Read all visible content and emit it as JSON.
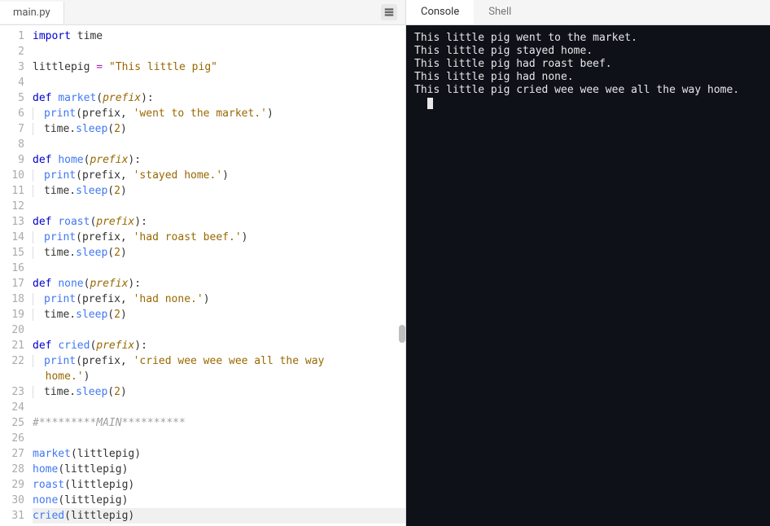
{
  "editor": {
    "filename": "main.py",
    "lines": [
      {
        "n": 1,
        "tokens": [
          {
            "t": "import",
            "c": "kw"
          },
          {
            "t": " ",
            "c": "p"
          },
          {
            "t": "time",
            "c": "id"
          }
        ]
      },
      {
        "n": 2,
        "tokens": []
      },
      {
        "n": 3,
        "tokens": [
          {
            "t": "littlepig ",
            "c": "id"
          },
          {
            "t": "=",
            "c": "op"
          },
          {
            "t": " ",
            "c": "p"
          },
          {
            "t": "\"This little pig\"",
            "c": "str"
          }
        ]
      },
      {
        "n": 4,
        "tokens": []
      },
      {
        "n": 5,
        "tokens": [
          {
            "t": "def ",
            "c": "kw"
          },
          {
            "t": "market",
            "c": "fn"
          },
          {
            "t": "(",
            "c": "p"
          },
          {
            "t": "prefix",
            "c": "param"
          },
          {
            "t": "):",
            "c": "p"
          }
        ]
      },
      {
        "n": 6,
        "tokens": [
          {
            "t": "| ",
            "c": "indent"
          },
          {
            "t": "print",
            "c": "call"
          },
          {
            "t": "(prefix, ",
            "c": "p"
          },
          {
            "t": "'went to the market.'",
            "c": "str"
          },
          {
            "t": ")",
            "c": "p"
          }
        ]
      },
      {
        "n": 7,
        "tokens": [
          {
            "t": "| ",
            "c": "indent"
          },
          {
            "t": "time.",
            "c": "id"
          },
          {
            "t": "sleep",
            "c": "call"
          },
          {
            "t": "(",
            "c": "p"
          },
          {
            "t": "2",
            "c": "num"
          },
          {
            "t": ")",
            "c": "p"
          }
        ]
      },
      {
        "n": 8,
        "tokens": []
      },
      {
        "n": 9,
        "tokens": [
          {
            "t": "def ",
            "c": "kw"
          },
          {
            "t": "home",
            "c": "fn"
          },
          {
            "t": "(",
            "c": "p"
          },
          {
            "t": "prefix",
            "c": "param"
          },
          {
            "t": "):",
            "c": "p"
          }
        ]
      },
      {
        "n": 10,
        "tokens": [
          {
            "t": "| ",
            "c": "indent"
          },
          {
            "t": "print",
            "c": "call"
          },
          {
            "t": "(prefix, ",
            "c": "p"
          },
          {
            "t": "'stayed home.'",
            "c": "str"
          },
          {
            "t": ")",
            "c": "p"
          }
        ]
      },
      {
        "n": 11,
        "tokens": [
          {
            "t": "| ",
            "c": "indent"
          },
          {
            "t": "time.",
            "c": "id"
          },
          {
            "t": "sleep",
            "c": "call"
          },
          {
            "t": "(",
            "c": "p"
          },
          {
            "t": "2",
            "c": "num"
          },
          {
            "t": ")",
            "c": "p"
          }
        ]
      },
      {
        "n": 12,
        "tokens": []
      },
      {
        "n": 13,
        "tokens": [
          {
            "t": "def ",
            "c": "kw"
          },
          {
            "t": "roast",
            "c": "fn"
          },
          {
            "t": "(",
            "c": "p"
          },
          {
            "t": "prefix",
            "c": "param"
          },
          {
            "t": "):",
            "c": "p"
          }
        ]
      },
      {
        "n": 14,
        "tokens": [
          {
            "t": "| ",
            "c": "indent"
          },
          {
            "t": "print",
            "c": "call"
          },
          {
            "t": "(prefix, ",
            "c": "p"
          },
          {
            "t": "'had roast beef.'",
            "c": "str"
          },
          {
            "t": ")",
            "c": "p"
          }
        ]
      },
      {
        "n": 15,
        "tokens": [
          {
            "t": "| ",
            "c": "indent"
          },
          {
            "t": "time.",
            "c": "id"
          },
          {
            "t": "sleep",
            "c": "call"
          },
          {
            "t": "(",
            "c": "p"
          },
          {
            "t": "2",
            "c": "num"
          },
          {
            "t": ")",
            "c": "p"
          }
        ]
      },
      {
        "n": 16,
        "tokens": []
      },
      {
        "n": 17,
        "tokens": [
          {
            "t": "def ",
            "c": "kw"
          },
          {
            "t": "none",
            "c": "fn"
          },
          {
            "t": "(",
            "c": "p"
          },
          {
            "t": "prefix",
            "c": "param"
          },
          {
            "t": "):",
            "c": "p"
          }
        ]
      },
      {
        "n": 18,
        "tokens": [
          {
            "t": "| ",
            "c": "indent"
          },
          {
            "t": "print",
            "c": "call"
          },
          {
            "t": "(prefix, ",
            "c": "p"
          },
          {
            "t": "'had none.'",
            "c": "str"
          },
          {
            "t": ")",
            "c": "p"
          }
        ]
      },
      {
        "n": 19,
        "tokens": [
          {
            "t": "| ",
            "c": "indent"
          },
          {
            "t": "time.",
            "c": "id"
          },
          {
            "t": "sleep",
            "c": "call"
          },
          {
            "t": "(",
            "c": "p"
          },
          {
            "t": "2",
            "c": "num"
          },
          {
            "t": ")",
            "c": "p"
          }
        ]
      },
      {
        "n": 20,
        "tokens": []
      },
      {
        "n": 21,
        "tokens": [
          {
            "t": "def ",
            "c": "kw"
          },
          {
            "t": "cried",
            "c": "fn"
          },
          {
            "t": "(",
            "c": "p"
          },
          {
            "t": "prefix",
            "c": "param"
          },
          {
            "t": "):",
            "c": "p"
          }
        ]
      },
      {
        "n": 22,
        "tokens": [
          {
            "t": "| ",
            "c": "indent"
          },
          {
            "t": "print",
            "c": "call"
          },
          {
            "t": "(prefix, ",
            "c": "p"
          },
          {
            "t": "'cried wee wee wee all the way ",
            "c": "str"
          }
        ],
        "wrap": [
          {
            "t": "  home.'",
            "c": "str"
          },
          {
            "t": ")",
            "c": "p"
          }
        ]
      },
      {
        "n": 23,
        "tokens": [
          {
            "t": "| ",
            "c": "indent"
          },
          {
            "t": "time.",
            "c": "id"
          },
          {
            "t": "sleep",
            "c": "call"
          },
          {
            "t": "(",
            "c": "p"
          },
          {
            "t": "2",
            "c": "num"
          },
          {
            "t": ")",
            "c": "p"
          }
        ]
      },
      {
        "n": 24,
        "tokens": []
      },
      {
        "n": 25,
        "tokens": [
          {
            "t": "#*********MAIN**********",
            "c": "cmt"
          }
        ]
      },
      {
        "n": 26,
        "tokens": []
      },
      {
        "n": 27,
        "tokens": [
          {
            "t": "market",
            "c": "call"
          },
          {
            "t": "(littlepig)",
            "c": "p"
          }
        ]
      },
      {
        "n": 28,
        "tokens": [
          {
            "t": "home",
            "c": "call"
          },
          {
            "t": "(littlepig)",
            "c": "p"
          }
        ]
      },
      {
        "n": 29,
        "tokens": [
          {
            "t": "roast",
            "c": "call"
          },
          {
            "t": "(littlepig)",
            "c": "p"
          }
        ]
      },
      {
        "n": 30,
        "tokens": [
          {
            "t": "none",
            "c": "call"
          },
          {
            "t": "(littlepig)",
            "c": "p"
          }
        ]
      },
      {
        "n": 31,
        "hl": true,
        "tokens": [
          {
            "t": "cried",
            "c": "call"
          },
          {
            "t": "(littlepig)",
            "c": "p"
          }
        ]
      }
    ]
  },
  "console": {
    "tabs": {
      "console": "Console",
      "shell": "Shell"
    },
    "active_tab": "console",
    "output": [
      "This little pig went to the market.",
      "This little pig stayed home.",
      "This little pig had roast beef.",
      "This little pig had none.",
      "This little pig cried wee wee wee all the way home."
    ],
    "prompt": ""
  }
}
